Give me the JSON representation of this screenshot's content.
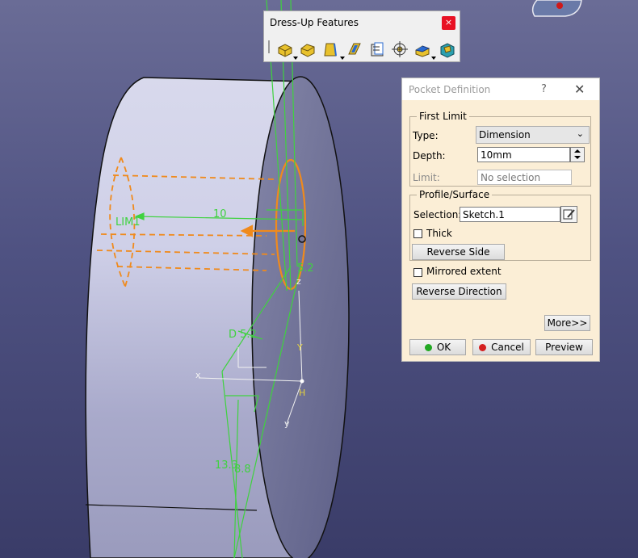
{
  "viewport": {
    "labels": {
      "lim1": "LIM1",
      "depth_dim": "10",
      "d_dim": "D 5.2",
      "dia_dim": "5.2",
      "dim_13_3": "13.3",
      "dim_8_8": "8.8",
      "axis_y": "Y",
      "axis_h": "H",
      "axis_z": "z",
      "axis_x": "x",
      "axis_v": "y"
    }
  },
  "dressup_toolbar": {
    "title": "Dress-Up Features",
    "close_glyph": "×",
    "tools": [
      "fillet-icon",
      "chamfer-icon",
      "draft-icon",
      "shell-icon",
      "thickness-icon",
      "thread-icon",
      "remove-face-icon",
      "replace-face-icon"
    ]
  },
  "pocket_dialog": {
    "title": "Pocket Definition",
    "help_glyph": "?",
    "close_glyph": "✕",
    "first_limit": {
      "legend": "First Limit",
      "type_label": "Type:",
      "type_value": "Dimension",
      "depth_label": "Depth:",
      "depth_value": "10mm",
      "limit_label": "Limit:",
      "limit_value": "No selection"
    },
    "profile_surface": {
      "legend": "Profile/Surface",
      "selection_label": "Selection:",
      "selection_value": "Sketch.1",
      "thick_label": "Thick",
      "thick_checked": false,
      "reverse_side": "Reverse Side"
    },
    "mirrored_extent_label": "Mirrored extent",
    "mirrored_checked": false,
    "reverse_direction": "Reverse Direction",
    "more": "More>>",
    "ok": "OK",
    "cancel": "Cancel",
    "preview": "Preview",
    "colors": {
      "ok_dot": "#22a822",
      "cancel_dot": "#d42020"
    }
  }
}
